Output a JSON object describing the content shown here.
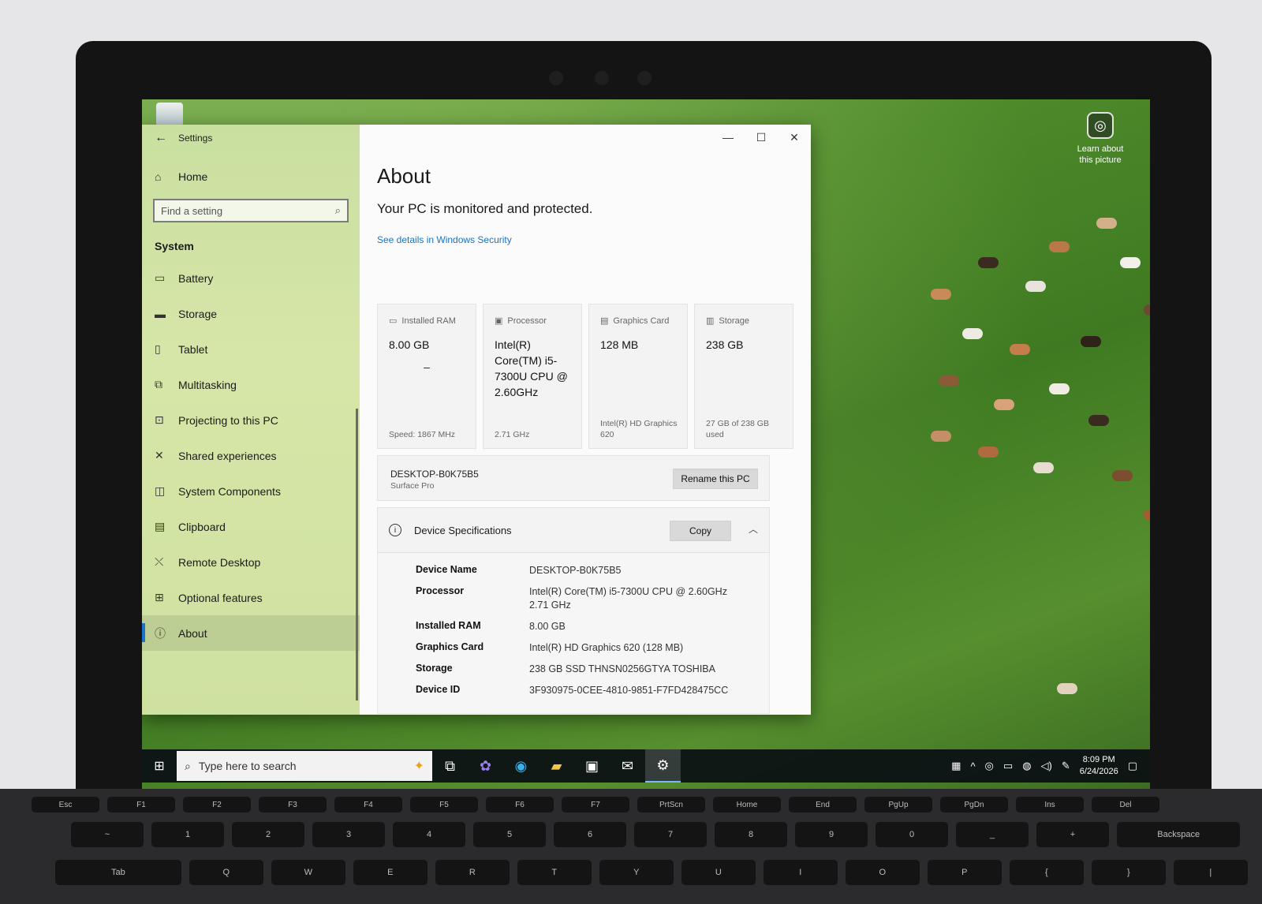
{
  "desktop": {
    "learn_label": "Learn about this picture"
  },
  "window": {
    "app_title": "Settings",
    "minimize": "—",
    "maximize": "☐",
    "close": "✕"
  },
  "sidebar": {
    "home_label": "Home",
    "search_placeholder": "Find a setting",
    "section_title": "System",
    "items": [
      {
        "label": "Battery",
        "icon": "battery-icon"
      },
      {
        "label": "Storage",
        "icon": "storage-icon"
      },
      {
        "label": "Tablet",
        "icon": "tablet-icon"
      },
      {
        "label": "Multitasking",
        "icon": "multitasking-icon"
      },
      {
        "label": "Projecting to this PC",
        "icon": "projecting-icon"
      },
      {
        "label": "Shared experiences",
        "icon": "shared-experiences-icon"
      },
      {
        "label": "System Components",
        "icon": "system-components-icon"
      },
      {
        "label": "Clipboard",
        "icon": "clipboard-icon"
      },
      {
        "label": "Remote Desktop",
        "icon": "remote-desktop-icon"
      },
      {
        "label": "Optional features",
        "icon": "optional-features-icon"
      },
      {
        "label": "About",
        "icon": "info-icon",
        "active": true
      }
    ]
  },
  "about": {
    "title": "About",
    "protection_text": "Your PC is monitored and protected.",
    "security_link": "See details in Windows Security",
    "cards": [
      {
        "header": "Installed RAM",
        "value": "8.00 GB",
        "extra": "–",
        "footer": "Speed: 1867 MHz"
      },
      {
        "header": "Processor",
        "value": "Intel(R) Core(TM) i5-7300U CPU @ 2.60GHz",
        "extra": "",
        "footer": "2.71 GHz"
      },
      {
        "header": "Graphics Card",
        "value": "128 MB",
        "extra": "",
        "footer": "Intel(R) HD Graphics 620"
      },
      {
        "header": "Storage",
        "value": "238 GB",
        "extra": "",
        "footer": "27 GB of 238 GB used"
      }
    ],
    "pc_name": "DESKTOP-B0K75B5",
    "pc_model": "Surface Pro",
    "rename_button": "Rename this PC",
    "specs_title": "Device Specifications",
    "copy_button": "Copy",
    "specs": [
      {
        "key": "Device Name",
        "value": "DESKTOP-B0K75B5",
        "sub": ""
      },
      {
        "key": "Processor",
        "value": "Intel(R) Core(TM) i5-7300U CPU @ 2.60GHz",
        "sub": "2.71 GHz"
      },
      {
        "key": "Installed RAM",
        "value": "8.00 GB",
        "sub": ""
      },
      {
        "key": "Graphics Card",
        "value": "Intel(R) HD Graphics 620 (128 MB)",
        "sub": ""
      },
      {
        "key": "Storage",
        "value": "238 GB SSD THNSN0256GTYA TOSHIBA",
        "sub": ""
      },
      {
        "key": "Device ID",
        "value": "3F930975-0CEE-4810-9851-F7FD428475CC",
        "sub": ""
      }
    ]
  },
  "taskbar": {
    "search_placeholder": "Type here to search",
    "time": "8:09 PM",
    "date": "6/24/2026"
  },
  "keyboard": {
    "fn_row": [
      "Esc",
      "F1",
      "F2",
      "F3",
      "F4",
      "F5",
      "F6",
      "F7",
      "PrtScn",
      "Home",
      "End",
      "PgUp",
      "PgDn",
      "Ins",
      "Del"
    ],
    "num_row": [
      "~",
      "1",
      "2",
      "3",
      "4",
      "5",
      "6",
      "7",
      "8",
      "9",
      "0",
      "_",
      "+",
      "Backspace"
    ],
    "q_row": [
      "Tab",
      "Q",
      "W",
      "E",
      "R",
      "T",
      "Y",
      "U",
      "I",
      "O",
      "P",
      "{",
      "}",
      "|"
    ]
  }
}
